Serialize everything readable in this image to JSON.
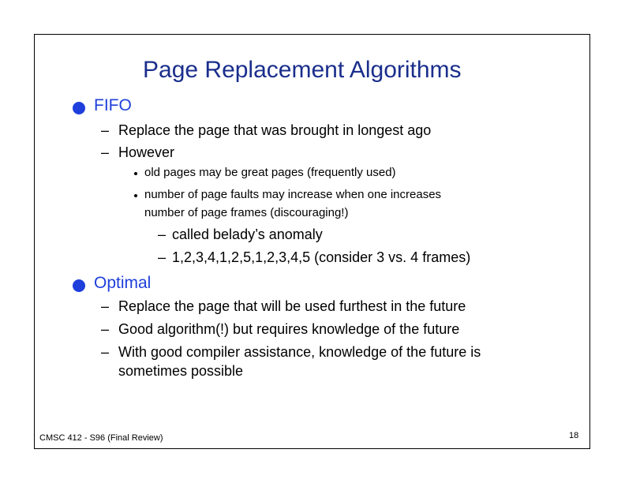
{
  "slide": {
    "title": "Page Replacement Algorithms",
    "sections": [
      {
        "heading": "FIFO",
        "items": [
          "Replace the page that was brought in longest ago",
          "However"
        ],
        "subitems": [
          "old pages may be great pages (frequently used)",
          "number of page faults may increase when one increases",
          "number of page frames (discouraging!)"
        ],
        "subsubitems": [
          "called belady’s anomaly",
          "1,2,3,4,1,2,5,1,2,3,4,5 (consider 3 vs. 4 frames)"
        ]
      },
      {
        "heading": "Optimal",
        "items": [
          "Replace the page that will be used furthest in the future",
          "Good  algorithm(!) but requires knowledge of the future",
          "With good compiler assistance, knowledge of the future is",
          "sometimes possible"
        ]
      }
    ],
    "dash": "–",
    "footer": "CMSC 412 - S96  (Final Review)",
    "page_number": "18"
  },
  "colors": {
    "title": "#1a2e8c",
    "heading": "#1e3fdc",
    "text": "#000000"
  }
}
